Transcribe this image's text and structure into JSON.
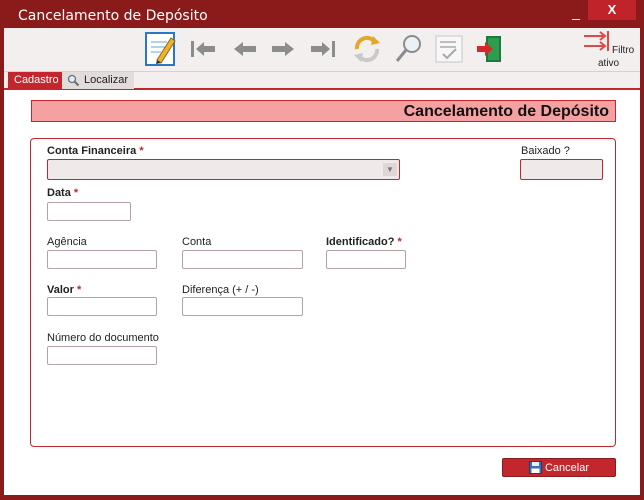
{
  "window": {
    "title": "Cancelamento de Depósito",
    "minimize_label": "_",
    "close_label": "X"
  },
  "toolbar": {
    "buttons": [
      {
        "name": "edit-icon",
        "color": "#2a78c2"
      },
      {
        "name": "first-record-icon",
        "color": "#9b9b9b"
      },
      {
        "name": "previous-record-icon",
        "color": "#9b9b9b"
      },
      {
        "name": "next-record-icon",
        "color": "#9b9b9b"
      },
      {
        "name": "last-record-icon",
        "color": "#9b9b9b"
      },
      {
        "name": "refresh-icon",
        "color": "#e0a92a"
      },
      {
        "name": "search-icon",
        "color": "#9b9b9b"
      },
      {
        "name": "checklist-icon",
        "color": "#b5b5b5"
      },
      {
        "name": "exit-icon",
        "color": "#1e7a3a"
      }
    ],
    "filter": {
      "line1": "Filtro",
      "line2": "ativo",
      "icon": "filter-arrows-icon",
      "color": "#e04848"
    }
  },
  "tabs": [
    {
      "label": "Cadastro",
      "active": true
    },
    {
      "label": "Localizar",
      "active": false,
      "icon": "magnifier-icon"
    }
  ],
  "heading": "Cancelamento de Depósito",
  "form": {
    "conta_financeira": {
      "label": "Conta Financeira",
      "required_mark": "*",
      "value": ""
    },
    "baixado": {
      "label": "Baixado ?",
      "value": ""
    },
    "data": {
      "label": "Data",
      "required_mark": "*",
      "value": ""
    },
    "agencia": {
      "label": "Agência",
      "value": ""
    },
    "conta": {
      "label": "Conta",
      "value": ""
    },
    "identificado": {
      "label": "Identificado?",
      "required_mark": "*",
      "value": ""
    },
    "valor": {
      "label": "Valor",
      "required_mark": "*",
      "value": ""
    },
    "diferenca": {
      "label": "Diferença (+ / -)",
      "value": ""
    },
    "numero_documento": {
      "label": "Número do documento",
      "value": ""
    }
  },
  "actions": {
    "cancel_label": "Cancelar",
    "cancel_icon": "floppy-disk-icon"
  },
  "colors": {
    "frame": "#8b1a1a",
    "accent": "#c1272d",
    "heading_bg": "#f6a1a1"
  }
}
